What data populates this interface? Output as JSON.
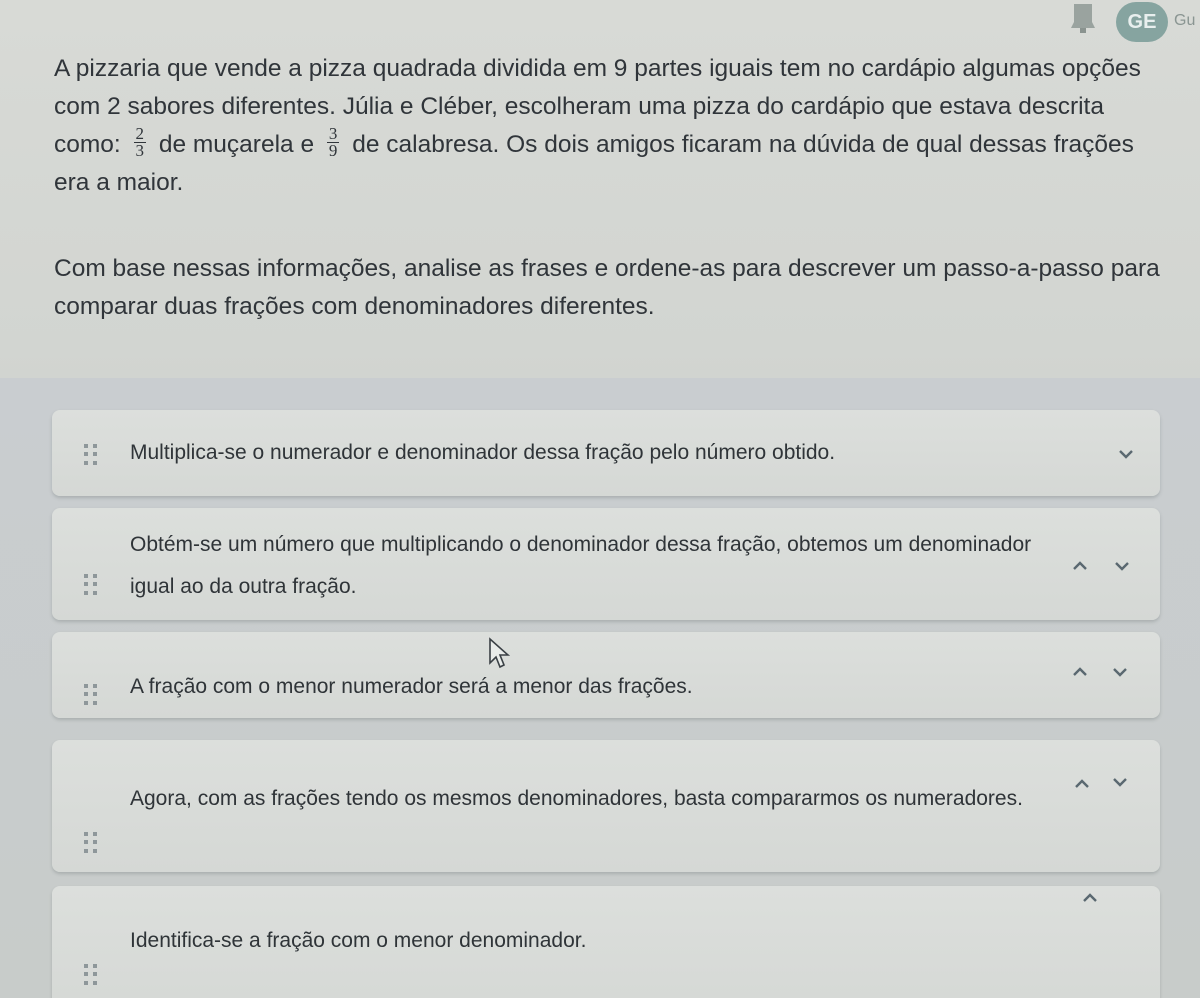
{
  "header": {
    "avatar_initials": "GE",
    "user_short": "Gu"
  },
  "question": {
    "paragraph_before_fraction_1": "A pizzaria que vende a pizza quadrada dividida em 9 partes iguais tem no cardápio algumas opções com 2 sabores diferentes. Júlia e Cléber, escolheram uma pizza do cardápio que estava descrita como: ",
    "fraction_1": {
      "numerator": "2",
      "denominator": "3"
    },
    "between_fractions": " de muçarela e ",
    "fraction_2": {
      "numerator": "3",
      "denominator": "9"
    },
    "paragraph_after_fraction_2": " de calabresa. Os dois amigos ficaram na dúvida de qual dessas frações era a maior."
  },
  "instruction": "Com base nessas informações, analise as frases e ordene-as para descrever um passo-a-passo para comparar duas frações com denominadores diferentes.",
  "items": [
    {
      "text": "Multiplica-se o numerador e denominador dessa fração pelo número obtido."
    },
    {
      "text": "Obtém-se um número que multiplicando o denominador dessa fração, obtemos um denominador igual ao da outra fração."
    },
    {
      "text": "A fração com o menor numerador será a menor das frações."
    },
    {
      "text": "Agora, com as frações tendo os mesmos denominadores, basta compararmos os numeradores."
    },
    {
      "text": "Identifica-se a fração com o menor denominador."
    }
  ],
  "colors": {
    "background": "#d2d5d1",
    "item_background": "#d9dcd9",
    "text": "#30353a",
    "avatar": "#86a4a0"
  }
}
